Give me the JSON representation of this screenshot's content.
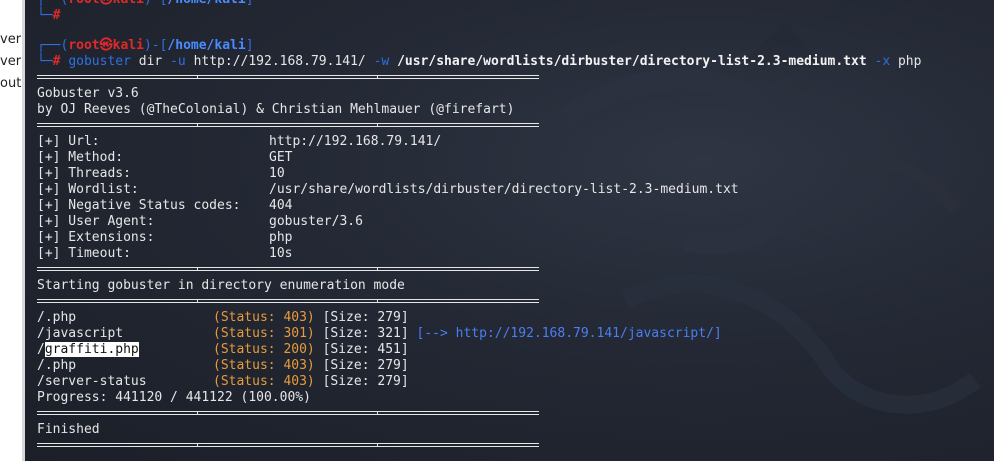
{
  "left_panel": {
    "lines": [
      "ver",
      "ver",
      "out"
    ]
  },
  "prompt_top": {
    "line1": "┌──(root㉿kali)-[/home/kali]",
    "line2": "└─#"
  },
  "prompt": {
    "open": "┌──(",
    "user": "root㉿kali",
    "mid": ")-[",
    "dir": "/home/kali",
    "close": "]",
    "hash_prefix": "└─",
    "hash": "#"
  },
  "command": {
    "program": "gobuster",
    "subcommand": "dir",
    "flag_u": "-u",
    "url": "http://192.168.79.141/",
    "flag_w": "-w",
    "wordlist": "/usr/share/wordlists/dirbuster/directory-list-2.3-medium.txt",
    "flag_x": "-x",
    "ext": "php"
  },
  "banner": {
    "line1": "Gobuster v3.6",
    "line2": "by OJ Reeves (@TheColonial) & Christian Mehlmauer (@firefart)"
  },
  "config": [
    {
      "key": "[+] Url:",
      "value": "http://192.168.79.141/"
    },
    {
      "key": "[+] Method:",
      "value": "GET"
    },
    {
      "key": "[+] Threads:",
      "value": "10"
    },
    {
      "key": "[+] Wordlist:",
      "value": "/usr/share/wordlists/dirbuster/directory-list-2.3-medium.txt"
    },
    {
      "key": "[+] Negative Status codes:",
      "value": "404"
    },
    {
      "key": "[+] User Agent:",
      "value": "gobuster/3.6"
    },
    {
      "key": "[+] Extensions:",
      "value": "php"
    },
    {
      "key": "[+] Timeout:",
      "value": "10s"
    }
  ],
  "starting": "Starting gobuster in directory enumeration mode",
  "results": [
    {
      "path": "/.php",
      "path_rest": "",
      "status": "(Status: 403)",
      "size": "[Size: 279]",
      "redirect": ""
    },
    {
      "path": "/javascript",
      "path_rest": "",
      "status": "(Status: 301)",
      "size": "[Size: 321]",
      "redirect": "[--> http://192.168.79.141/javascript/]"
    },
    {
      "path": "/",
      "path_rest": "graffiti.php",
      "status": "(Status: 200)",
      "size": "[Size: 451]",
      "redirect": ""
    },
    {
      "path": "/.php",
      "path_rest": "",
      "status": "(Status: 403)",
      "size": "[Size: 279]",
      "redirect": ""
    },
    {
      "path": "/server-status",
      "path_rest": "",
      "status": "(Status: 403)",
      "size": "[Size: 279]",
      "redirect": ""
    }
  ],
  "progress": "Progress: 441120 / 441122 (100.00%)",
  "finished": "Finished",
  "colors": {
    "terminal_bg": "#232834",
    "prompt_blue": "#2f6fe0",
    "user_red": "#e02a2a",
    "status_orange": "#e89a3c",
    "redirect_blue": "#4a7ff0"
  }
}
